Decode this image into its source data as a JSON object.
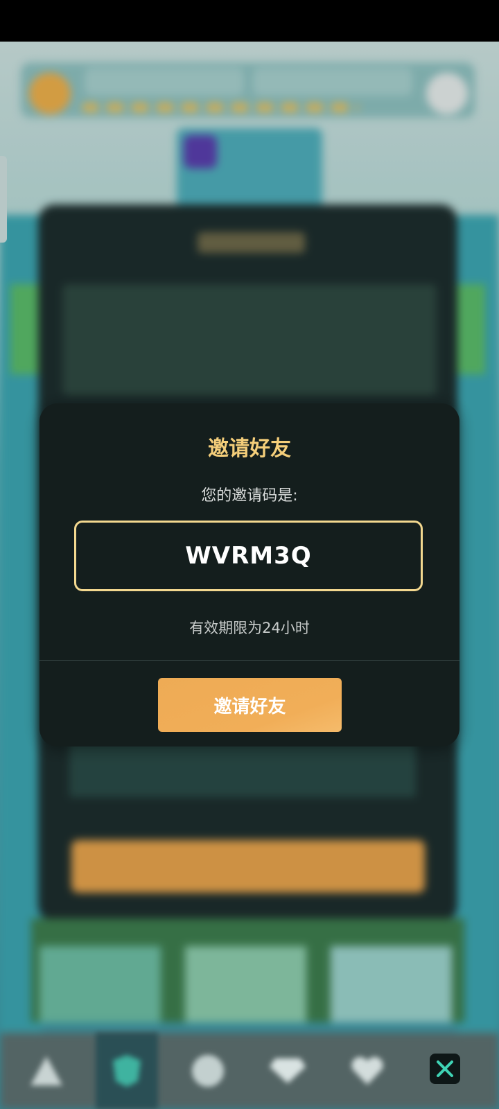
{
  "dialog": {
    "title": "邀请好友",
    "subtitle": "您的邀请码是:",
    "invite_code": "WVRM3Q",
    "validity": "有效期限为24小时",
    "button_label": "邀请好友"
  },
  "colors": {
    "title_gold": "#f4ce7a",
    "code_border": "#f3d88f",
    "button_orange": "#f1ae58",
    "dialog_bg": "#141e1d",
    "close_accent": "#3fd3b5"
  },
  "nav": {
    "icons": [
      "warning-triangle-icon",
      "shield-icon",
      "gear-icon",
      "gem-icon",
      "heart-icon"
    ],
    "close_icon": "close-icon"
  }
}
